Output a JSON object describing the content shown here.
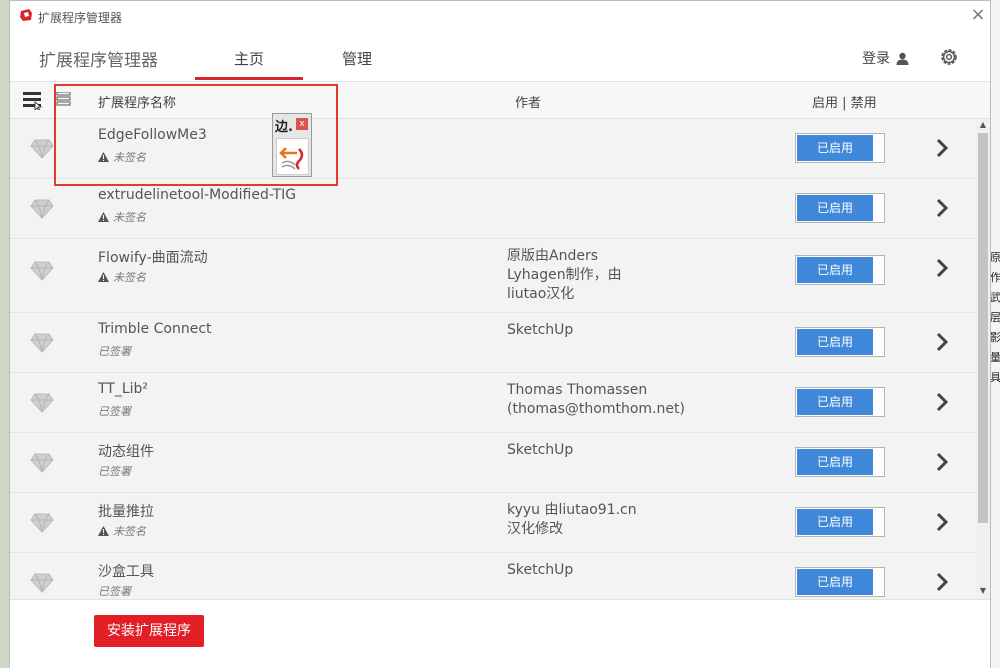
{
  "window_title": "扩展程序管理器",
  "nav": {
    "brand": "扩展程序管理器",
    "tab_home": "主页",
    "tab_manage": "管理",
    "login": "登录"
  },
  "header": {
    "col_name": "扩展程序名称",
    "col_author": "作者",
    "col_toggle": "启用 | 禁用"
  },
  "extensions": [
    {
      "name": "EdgeFollowMe3",
      "signature": "未签名",
      "signed": false,
      "author": [
        "",
        "",
        ""
      ],
      "status": "已启用"
    },
    {
      "name": "extrudelinetool-Modified-TIG",
      "signature": "未签名",
      "signed": false,
      "author": [
        "",
        "",
        ""
      ],
      "status": "已启用"
    },
    {
      "name": "Flowify-曲面流动",
      "signature": "未签名",
      "signed": false,
      "author": [
        "原版由Anders",
        "Lyhagen制作，由",
        "liutao汉化"
      ],
      "status": "已启用"
    },
    {
      "name": "Trimble Connect",
      "signature": "已签署",
      "signed": true,
      "author": [
        "SketchUp",
        "",
        ""
      ],
      "status": "已启用"
    },
    {
      "name": "TT_Lib²",
      "signature": "已签署",
      "signed": true,
      "author": [
        "Thomas Thomassen",
        "(thomas@thomthom.net)",
        ""
      ],
      "status": "已启用"
    },
    {
      "name": "动态组件",
      "signature": "已签署",
      "signed": true,
      "author": [
        "SketchUp",
        "",
        ""
      ],
      "status": "已启用"
    },
    {
      "name": "批量推拉",
      "signature": "未签名",
      "signed": false,
      "author": [
        "kyyu 由liutao91.cn",
        "汉化修改",
        ""
      ],
      "status": "已启用"
    },
    {
      "name": "沙盒工具",
      "signature": "已签署",
      "signed": true,
      "author": [
        "SketchUp",
        "",
        ""
      ],
      "status": "已启用"
    }
  ],
  "install_button": "安装扩展程序",
  "toolbar_popup": {
    "label": "边.",
    "close": "x"
  },
  "background_glyphs": [
    "原",
    "作",
    "武",
    "层",
    "影",
    "量",
    "具"
  ],
  "colors": {
    "accent_red": "#d9262c",
    "toggle_blue": "#3f87d8",
    "install_red": "#e21e26"
  }
}
